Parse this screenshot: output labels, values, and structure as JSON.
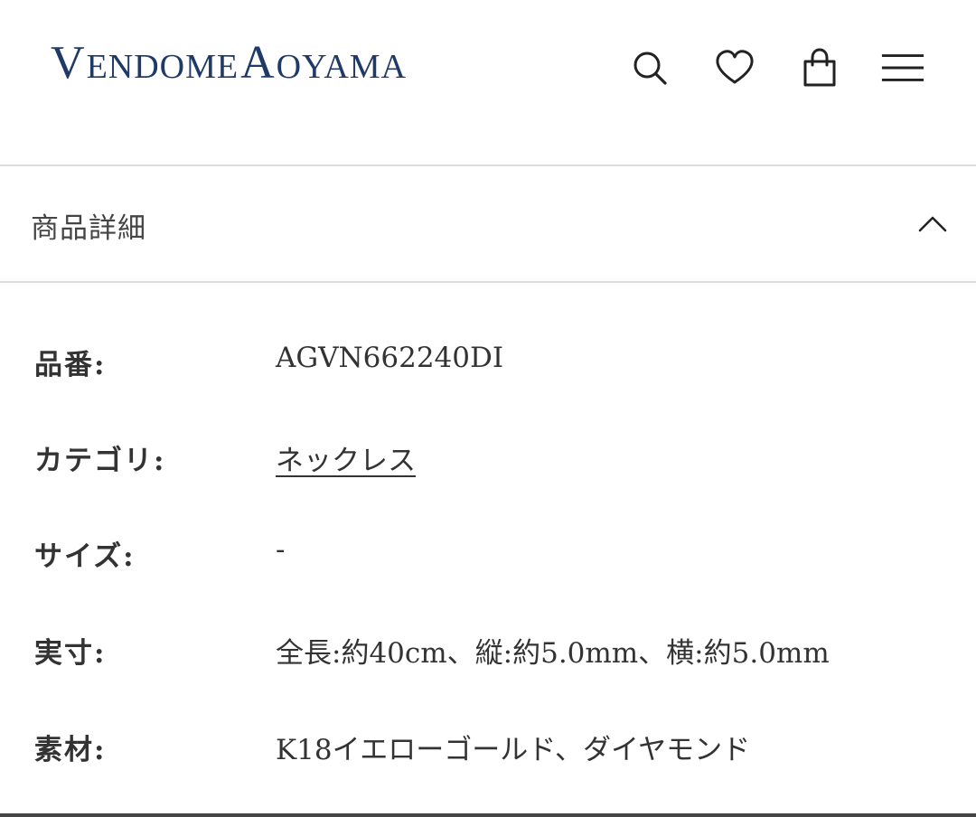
{
  "header": {
    "logo_text": "VendomeAoyama",
    "icons": [
      "search-icon",
      "heart-icon",
      "bag-icon",
      "menu-icon"
    ],
    "brand_color": "#1f3a66"
  },
  "section": {
    "title": "商品詳細",
    "expanded": true
  },
  "details": [
    {
      "label": "品番:",
      "value": "AGVN662240DI",
      "is_link": false
    },
    {
      "label": "カテゴリ:",
      "value": "ネックレス",
      "is_link": true
    },
    {
      "label": "サイズ:",
      "value": "-",
      "is_link": false
    },
    {
      "label": "実寸:",
      "value": "全長:約40cm、縦:約5.0mm、横:約5.0mm",
      "is_link": false
    },
    {
      "label": "素材:",
      "value": "K18イエローゴールド、ダイヤモンド",
      "is_link": false
    }
  ]
}
